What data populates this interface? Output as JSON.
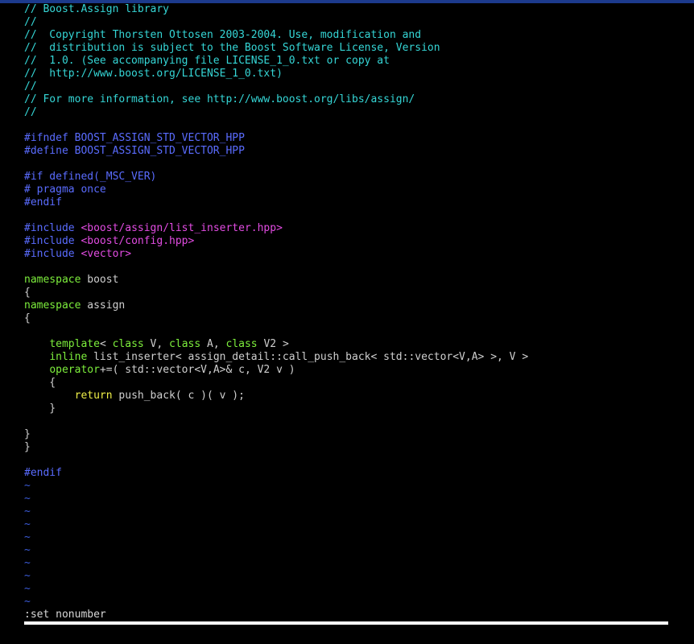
{
  "editor": {
    "lines": [
      [
        {
          "t": "// Boost.Assign library",
          "c": "comment"
        }
      ],
      [
        {
          "t": "//",
          "c": "comment"
        }
      ],
      [
        {
          "t": "//  Copyright Thorsten Ottosen 2003-2004. Use, modification and",
          "c": "comment"
        }
      ],
      [
        {
          "t": "//  distribution is subject to the Boost Software License, Version",
          "c": "comment"
        }
      ],
      [
        {
          "t": "//  1.0. (See accompanying file LICENSE_1_0.txt or copy at",
          "c": "comment"
        }
      ],
      [
        {
          "t": "//  http://www.boost.org/LICENSE_1_0.txt)",
          "c": "comment"
        }
      ],
      [
        {
          "t": "//",
          "c": "comment"
        }
      ],
      [
        {
          "t": "// For more information, see http://www.boost.org/libs/assign/",
          "c": "comment"
        }
      ],
      [
        {
          "t": "//",
          "c": "comment"
        }
      ],
      [],
      [
        {
          "t": "#ifndef BOOST_ASSIGN_STD_VECTOR_HPP",
          "c": "preproc"
        }
      ],
      [
        {
          "t": "#define BOOST_ASSIGN_STD_VECTOR_HPP",
          "c": "preproc"
        }
      ],
      [],
      [
        {
          "t": "#if defined(_MSC_VER)",
          "c": "preproc"
        }
      ],
      [
        {
          "t": "# pragma once",
          "c": "preproc"
        }
      ],
      [
        {
          "t": "#endif",
          "c": "preproc"
        }
      ],
      [],
      [
        {
          "t": "#include ",
          "c": "preproc"
        },
        {
          "t": "<boost/assign/list_inserter.hpp>",
          "c": "include"
        }
      ],
      [
        {
          "t": "#include ",
          "c": "preproc"
        },
        {
          "t": "<boost/config.hpp>",
          "c": "include"
        }
      ],
      [
        {
          "t": "#include ",
          "c": "preproc"
        },
        {
          "t": "<vector>",
          "c": "include"
        }
      ],
      [],
      [
        {
          "t": "namespace",
          "c": "keyword"
        },
        {
          "t": " boost",
          "c": "text"
        }
      ],
      [
        {
          "t": "{",
          "c": "text"
        }
      ],
      [
        {
          "t": "namespace",
          "c": "keyword"
        },
        {
          "t": " assign",
          "c": "text"
        }
      ],
      [
        {
          "t": "{",
          "c": "text"
        }
      ],
      [],
      [
        {
          "t": "    ",
          "c": "text"
        },
        {
          "t": "template",
          "c": "keyword"
        },
        {
          "t": "< ",
          "c": "text"
        },
        {
          "t": "class",
          "c": "keyword"
        },
        {
          "t": " V, ",
          "c": "text"
        },
        {
          "t": "class",
          "c": "keyword"
        },
        {
          "t": " A, ",
          "c": "text"
        },
        {
          "t": "class",
          "c": "keyword"
        },
        {
          "t": " V2 >",
          "c": "text"
        }
      ],
      [
        {
          "t": "    ",
          "c": "text"
        },
        {
          "t": "inline",
          "c": "keyword"
        },
        {
          "t": " list_inserter< assign_detail::call_push_back< std::vector<V,A> >, V >",
          "c": "text"
        }
      ],
      [
        {
          "t": "    ",
          "c": "text"
        },
        {
          "t": "operator",
          "c": "keyword"
        },
        {
          "t": "+=( std::vector<V,A>& c, V2 v )",
          "c": "text"
        }
      ],
      [
        {
          "t": "    {",
          "c": "text"
        }
      ],
      [
        {
          "t": "        ",
          "c": "text"
        },
        {
          "t": "return",
          "c": "control"
        },
        {
          "t": " push_back( c )( v );",
          "c": "text"
        }
      ],
      [
        {
          "t": "    }",
          "c": "text"
        }
      ],
      [],
      [
        {
          "t": "}",
          "c": "text"
        }
      ],
      [
        {
          "t": "}",
          "c": "text"
        }
      ],
      [],
      [
        {
          "t": "#endif",
          "c": "preproc"
        }
      ],
      [
        {
          "t": "~",
          "c": "tilde"
        }
      ],
      [
        {
          "t": "~",
          "c": "tilde"
        }
      ],
      [
        {
          "t": "~",
          "c": "tilde"
        }
      ],
      [
        {
          "t": "~",
          "c": "tilde"
        }
      ],
      [
        {
          "t": "~",
          "c": "tilde"
        }
      ],
      [
        {
          "t": "~",
          "c": "tilde"
        }
      ],
      [
        {
          "t": "~",
          "c": "tilde"
        }
      ],
      [
        {
          "t": "~",
          "c": "tilde"
        }
      ],
      [
        {
          "t": "~",
          "c": "tilde"
        }
      ],
      [
        {
          "t": "~",
          "c": "tilde"
        }
      ]
    ]
  },
  "command_line": {
    "text": ":set nonumber"
  },
  "colors": {
    "background": "#000000",
    "top_bar": "#1c3a8c",
    "comment": "#35d6d6",
    "preproc": "#5a6cff",
    "include": "#e24ce2",
    "keyword": "#7dee3c",
    "control": "#f0f048",
    "text": "#cfcfcf",
    "tilde": "#3b5bd8",
    "status_bar": "#ffffff"
  }
}
